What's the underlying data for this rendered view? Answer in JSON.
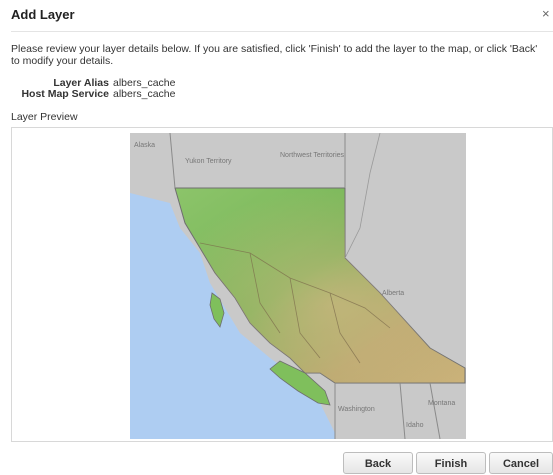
{
  "dialog": {
    "title": "Add Layer",
    "close_glyph": "×",
    "intro": "Please review your layer details below. If you are satisfied, click 'Finish' to add the layer to the map, or click 'Back' to modify your details."
  },
  "details": [
    {
      "label": "Layer Alias",
      "value": "albers_cache"
    },
    {
      "label": "Host Map Service",
      "value": "albers_cache"
    }
  ],
  "preview": {
    "label": "Layer Preview",
    "places": {
      "alaska": "Alaska",
      "yukon": "Yukon Territory",
      "nwt": "Northwest Territories",
      "alberta": "Alberta",
      "washington": "Washington",
      "montana": "Montana",
      "idaho": "Idaho"
    },
    "colors": {
      "land_outside": "#c9c9c9",
      "water": "#aecdf2",
      "lowland": "#7fbf5c",
      "upland": "#c8b47c"
    }
  },
  "buttons": {
    "back": "Back",
    "finish": "Finish",
    "cancel": "Cancel"
  }
}
